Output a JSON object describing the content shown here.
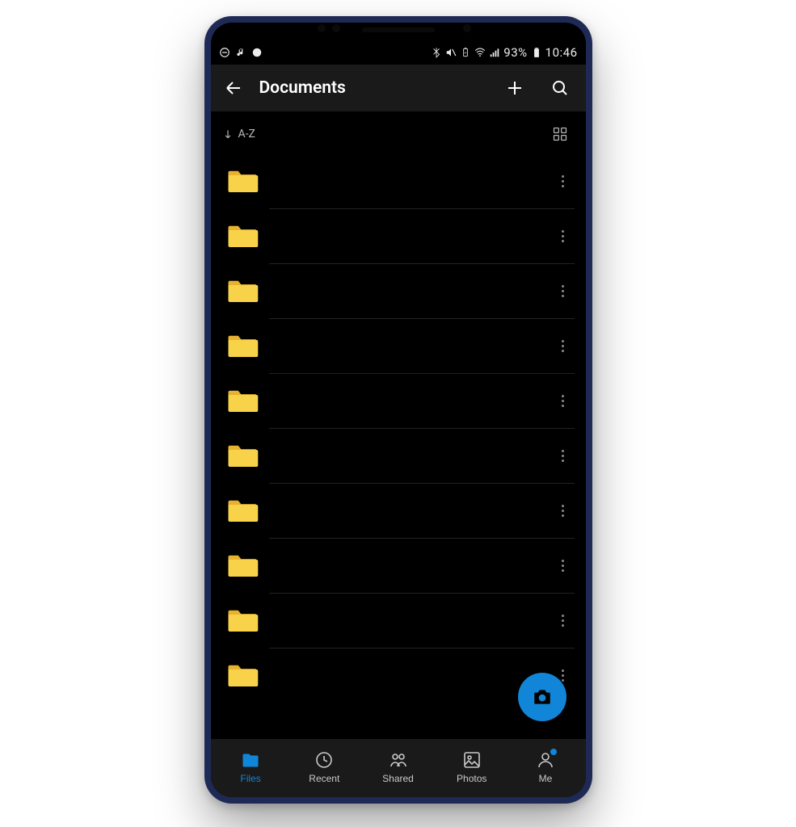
{
  "status": {
    "battery_text": "93%",
    "time": "10:46"
  },
  "header": {
    "title": "Documents",
    "back": "Back",
    "add": "Add",
    "search": "Search"
  },
  "sort": {
    "label": "A-Z",
    "view_toggle": "Grid view"
  },
  "folders": [
    {
      "name": ""
    },
    {
      "name": ""
    },
    {
      "name": ""
    },
    {
      "name": ""
    },
    {
      "name": ""
    },
    {
      "name": ""
    },
    {
      "name": ""
    },
    {
      "name": ""
    },
    {
      "name": ""
    },
    {
      "name": ""
    }
  ],
  "fab": {
    "label": "Scan"
  },
  "nav": {
    "items": [
      {
        "id": "files",
        "label": "Files",
        "active": true
      },
      {
        "id": "recent",
        "label": "Recent",
        "active": false
      },
      {
        "id": "shared",
        "label": "Shared",
        "active": false
      },
      {
        "id": "photos",
        "label": "Photos",
        "active": false
      },
      {
        "id": "me",
        "label": "Me",
        "active": false,
        "badge": true
      }
    ]
  },
  "colors": {
    "accent": "#1186d8",
    "folder": "#f8d34a"
  }
}
